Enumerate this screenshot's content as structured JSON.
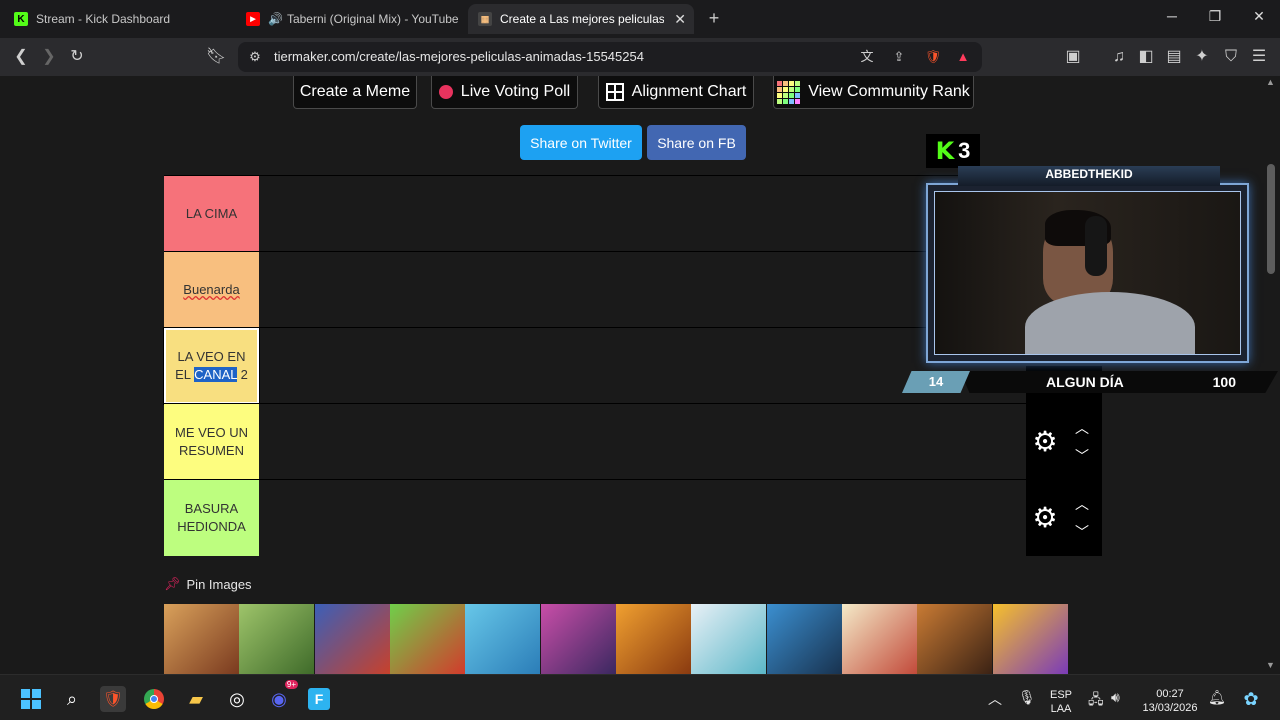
{
  "browser": {
    "tabs": [
      {
        "title": "Stream - Kick Dashboard",
        "favicon": "kick-icon",
        "active": false
      },
      {
        "title": "Taberni (Original Mix) - YouTube",
        "favicon": "youtube-icon",
        "active": false
      },
      {
        "title": "Create a Las mejores peliculas ar",
        "favicon": "tiermaker-icon",
        "active": true
      }
    ],
    "new_tab": "+",
    "url": "tiermaker.com/create/las-mejores-peliculas-animadas-15545254"
  },
  "page": {
    "top_buttons": {
      "meme": "Create a Meme",
      "poll": "Live Voting Poll",
      "alignment": "Alignment Chart",
      "community": "View Community Rank"
    },
    "share": {
      "twitter": "Share on Twitter",
      "fb": "Share on FB"
    },
    "tiers": [
      {
        "label": "LA CIMA",
        "color": "#f6727a"
      },
      {
        "label": "Buenarda",
        "color": "#f8bf7f"
      },
      {
        "label_pre": "LA VEO EN EL ",
        "label_sel": "CANAL",
        "label_post": " 2",
        "color": "#f8df80"
      },
      {
        "label": "ME VEO UN RESUMEN",
        "color": "#fdfd7f"
      },
      {
        "label": "BASURA HEDIONDA",
        "color": "#bdfe7f"
      }
    ],
    "pin_images": "Pin Images"
  },
  "overlay": {
    "kick_count": "3",
    "streamer_name": "ABBEDTHEKID",
    "level": "14",
    "song": "ALGUN DÍA",
    "points": "100"
  },
  "taskbar": {
    "lang": "ESP",
    "layout": "LAA",
    "time": "00:27",
    "date": "13/03/2026",
    "discord_badge": "9+"
  }
}
